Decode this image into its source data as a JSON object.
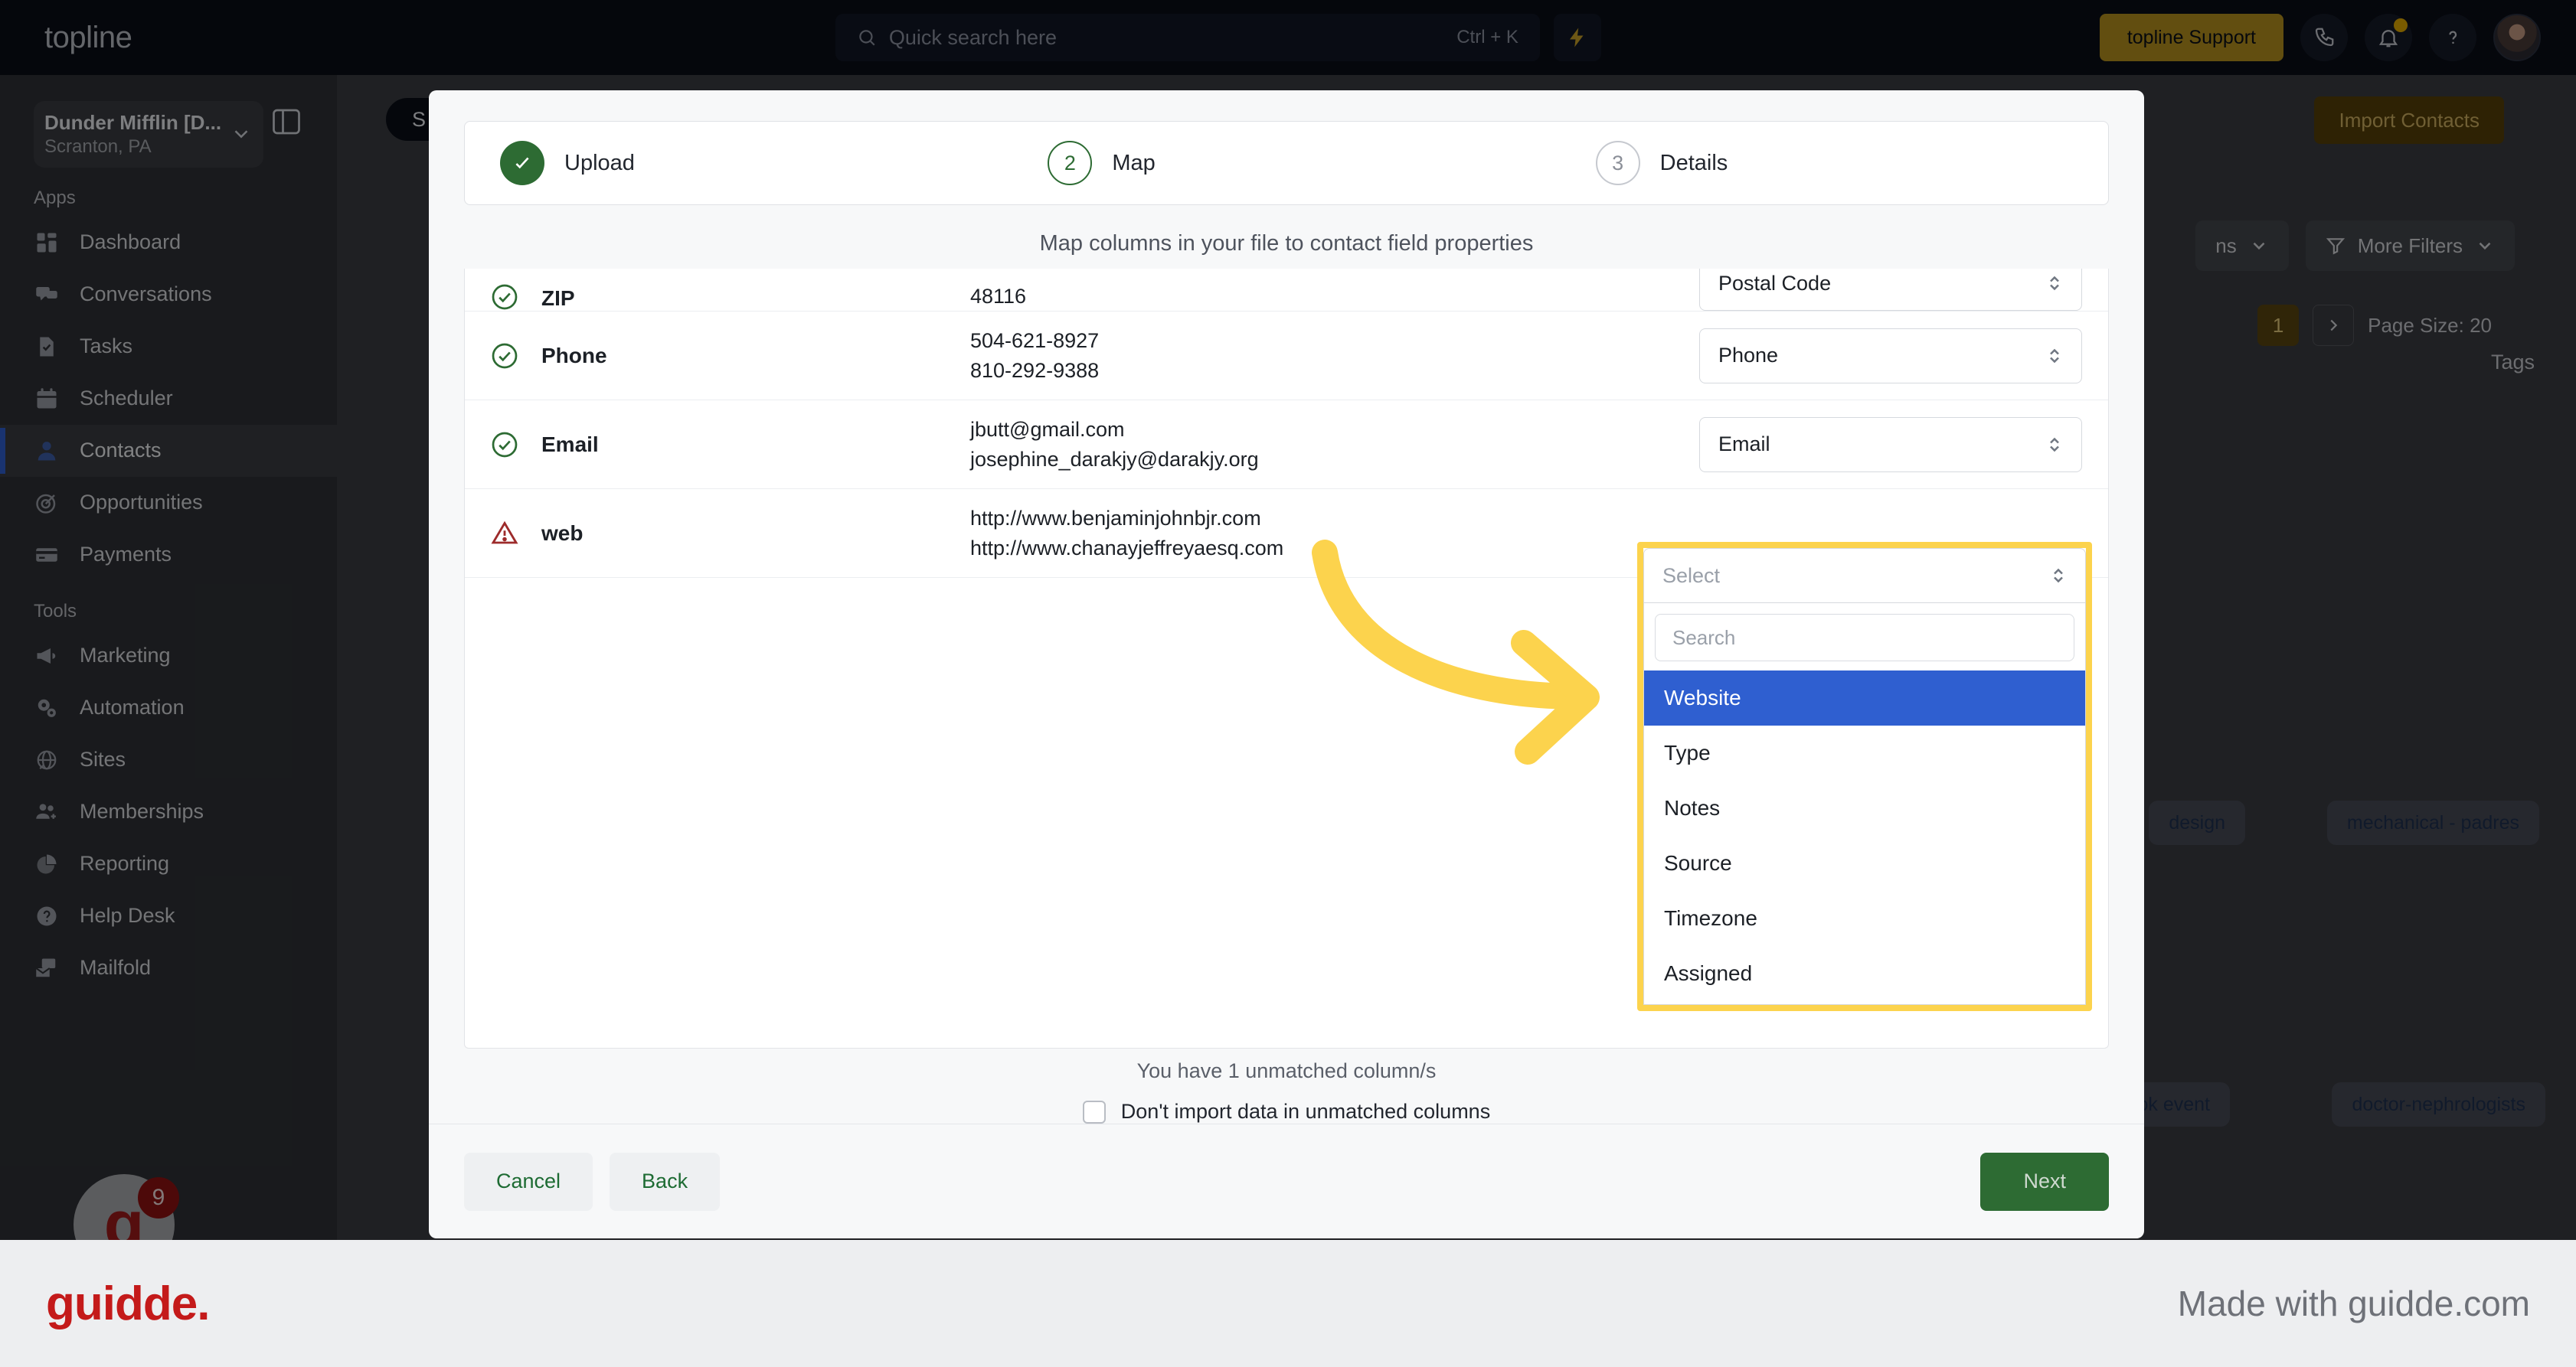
{
  "topbar": {
    "logo": "topline",
    "search": {
      "placeholder": "Quick search here",
      "shortcut": "Ctrl + K",
      "icon": "search-icon"
    },
    "bolt_icon": "lightning-bolt-icon",
    "support_button": "topline Support",
    "phone_icon": "phone-icon",
    "bell_icon": "bell-icon",
    "help_icon": "question-mark-icon",
    "avatar": "user-avatar"
  },
  "sidebar": {
    "account": {
      "name": "Dunder Mifflin [D...",
      "location": "Scranton, PA",
      "chevron": "chevron-down-icon"
    },
    "panel_toggle_icon": "sidebar-panel-icon",
    "sections": [
      {
        "title": "Apps",
        "items": [
          {
            "label": "Dashboard",
            "icon": "dashboard-icon",
            "active": false
          },
          {
            "label": "Conversations",
            "icon": "chat-bubbles-icon",
            "active": false
          },
          {
            "label": "Tasks",
            "icon": "task-check-icon",
            "active": false
          },
          {
            "label": "Scheduler",
            "icon": "calendar-icon",
            "active": false
          },
          {
            "label": "Contacts",
            "icon": "person-icon",
            "active": true
          },
          {
            "label": "Opportunities",
            "icon": "target-icon",
            "active": false
          },
          {
            "label": "Payments",
            "icon": "credit-card-icon",
            "active": false
          }
        ]
      },
      {
        "title": "Tools",
        "items": [
          {
            "label": "Marketing",
            "icon": "megaphone-icon",
            "active": false
          },
          {
            "label": "Automation",
            "icon": "gears-icon",
            "active": false
          },
          {
            "label": "Sites",
            "icon": "globe-icon",
            "active": false
          },
          {
            "label": "Memberships",
            "icon": "people-plus-icon",
            "active": false
          },
          {
            "label": "Reporting",
            "icon": "pie-chart-icon",
            "active": false
          },
          {
            "label": "Help Desk",
            "icon": "help-circle-icon",
            "active": false
          },
          {
            "label": "Mailfold",
            "icon": "mail-stack-icon",
            "active": false
          }
        ]
      }
    ],
    "badge_widget": {
      "letter": "g",
      "count": "9"
    }
  },
  "background_page": {
    "spill_pill": "S",
    "import_button": "Import Contacts",
    "actions_chip": "ns",
    "more_filters_chip": "More Filters",
    "filter_icon": "funnel-icon",
    "tags_header": "Tags",
    "pagination": {
      "current_page": "1",
      "next_icon": "chevron-right-icon",
      "page_size": "Page Size: 20"
    },
    "tags": [
      "design",
      "mechanical - padres",
      "book event",
      "doctor-nephrologists"
    ]
  },
  "modal": {
    "steps": [
      {
        "number": "1",
        "label": "Upload",
        "state": "done",
        "icon": "check-icon"
      },
      {
        "number": "2",
        "label": "Map",
        "state": "current"
      },
      {
        "number": "3",
        "label": "Details",
        "state": "todo"
      }
    ],
    "subtitle": "Map columns in your file to contact field properties",
    "rows": [
      {
        "status": "matched",
        "status_icon": "check-circle-icon",
        "column": "ZIP",
        "values": [
          "48116"
        ],
        "mapped": "Postal Code",
        "clipped": true
      },
      {
        "status": "matched",
        "status_icon": "check-circle-icon",
        "column": "Phone",
        "values": [
          "504-621-8927",
          "810-292-9388"
        ],
        "mapped": "Phone",
        "clipped": false
      },
      {
        "status": "matched",
        "status_icon": "check-circle-icon",
        "column": "Email",
        "values": [
          "jbutt@gmail.com",
          "josephine_darakjy@darakjy.org"
        ],
        "mapped": "Email",
        "clipped": false
      },
      {
        "status": "unmatched",
        "status_icon": "warning-triangle-icon",
        "column": "web",
        "values": [
          "http://www.benjaminjohnbjr.com",
          "http://www.chanayjeffreyaesq.com"
        ],
        "mapped": "",
        "mapped_placeholder": "Select",
        "clipped": false
      }
    ],
    "unmatched_note": "You have 1 unmatched column/s",
    "dont_import_label": "Don't import data in unmatched columns",
    "dont_import_checked": false,
    "cancel_button": "Cancel",
    "back_button": "Back",
    "next_button": "Next"
  },
  "dropdown": {
    "placeholder": "Select",
    "search_placeholder": "Search",
    "options": [
      "Website",
      "Type",
      "Notes",
      "Source",
      "Timezone",
      "Assigned"
    ],
    "selected": "Website",
    "highlight_color": "#fcd34d",
    "selected_color": "#2f5fd0"
  },
  "annotation": {
    "arrow_color": "#fcd34d",
    "arrow": "curved-right-arrow"
  },
  "footer": {
    "logo": "guidde.",
    "right_text": "Made with guidde.com",
    "logo_color": "#c41a1a"
  }
}
